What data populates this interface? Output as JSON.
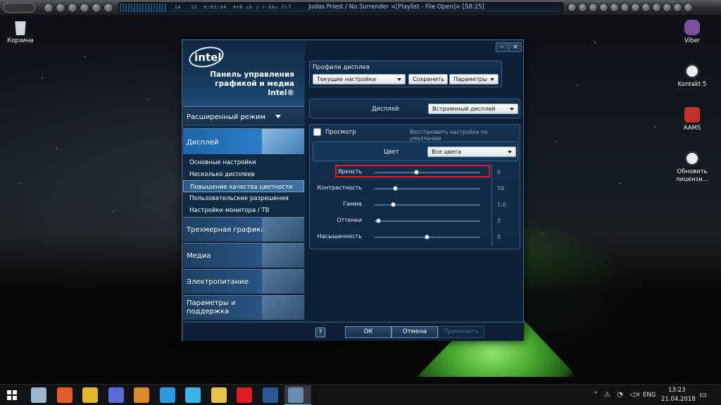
{
  "player": {
    "counter_a": "14",
    "counter_b": "12",
    "time": "0:02:54",
    "flags": "A+B  cb  ♪  ☀  bbc",
    "tag": "FLT",
    "now_playing": "Judas Priest / No Surrender   <[Playlist - File Open]> [58:25]"
  },
  "desktop_icons": [
    {
      "label": "Корзина",
      "color": "#cfd6dd"
    },
    {
      "label": "Viber",
      "color": "#7b519d"
    },
    {
      "label": "Kontakt 5",
      "color": "#e8eef5"
    },
    {
      "label": "AAMS",
      "color": "#c4302b"
    },
    {
      "label": "Обновить лицензи...",
      "color": "#e8eef5"
    }
  ],
  "window": {
    "brand_logo": "intel",
    "brand_title": "Панель управления\nграфикой и медиа\nIntel®",
    "mode_dropdown": "Расширенный режим",
    "categories": {
      "display": "Дисплей",
      "graphics3d": "Трехмерная графика",
      "media": "Медиа",
      "power": "Электропитание",
      "support": "Параметры и\nподдержка"
    },
    "display_subitems": [
      "Основные настройки",
      "Несколько дисплеев",
      "Повышение качества цветности",
      "Пользовательские разрешения",
      "Настройки монитора / ТВ"
    ],
    "title_buttons": {
      "minimize": "–",
      "close": "×"
    },
    "profiles": {
      "heading": "Профили дисплея",
      "current": "Текущие настройки",
      "save": "Сохранить",
      "params": "Параметры"
    },
    "display_select": {
      "label": "Дисплей",
      "value": "Встроенный дисплей"
    },
    "preview": {
      "label": "Просмотр",
      "restore": "Восстановить настройки по умолчанию"
    },
    "color_select": {
      "label": "Цвет",
      "value": "Все цвета"
    },
    "sliders": [
      {
        "label": "Яркость",
        "value": "0",
        "position": 0.4
      },
      {
        "label": "Контрастность",
        "value": "50",
        "position": 0.2
      },
      {
        "label": "Гамма",
        "value": "1,0",
        "position": 0.18
      },
      {
        "label": "Оттенки",
        "value": "0",
        "position": 0.04
      },
      {
        "label": "Насыщенность",
        "value": "0",
        "position": 0.5
      }
    ],
    "footer": {
      "help": "?",
      "ok": "ОК",
      "cancel": "Отмена",
      "apply": "Применить"
    }
  },
  "taskbar": {
    "language": "ENG",
    "time": "13:23",
    "date": "21.04.2018",
    "apps": [
      {
        "name": "app-1",
        "color": "#9ab7d0"
      },
      {
        "name": "app-2",
        "color": "#e35b2a"
      },
      {
        "name": "app-3",
        "color": "#e0b82a"
      },
      {
        "name": "app-4",
        "color": "#5a6ad8"
      },
      {
        "name": "app-5",
        "color": "#d88a2a"
      },
      {
        "name": "app-6",
        "color": "#2a9ae0"
      },
      {
        "name": "app-7",
        "color": "#3ab4e8"
      },
      {
        "name": "explorer",
        "color": "#e8c24a"
      },
      {
        "name": "opera",
        "color": "#e01b24"
      },
      {
        "name": "word",
        "color": "#2b5797"
      },
      {
        "name": "intel-graphics",
        "color": "#6a8cae"
      }
    ]
  }
}
